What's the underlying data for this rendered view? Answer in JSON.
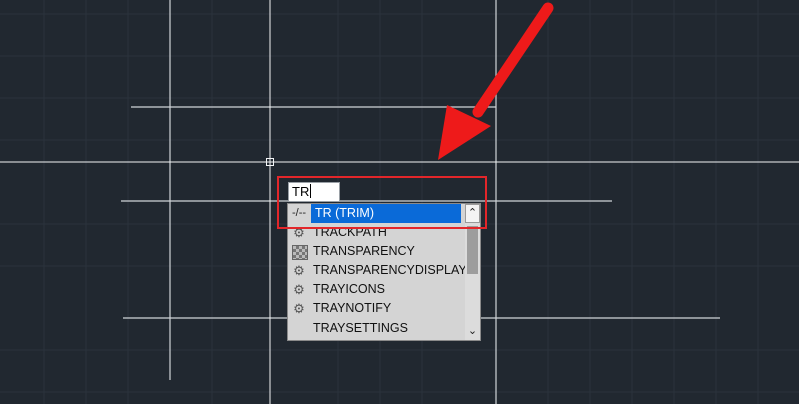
{
  "command_line": {
    "typed_text": "TR"
  },
  "autocomplete": {
    "items": [
      {
        "label": "TR (TRIM)",
        "icon": "trim-icon",
        "selected": true
      },
      {
        "label": "TRACKPATH",
        "icon": "gear-icon"
      },
      {
        "label": "TRANSPARENCY",
        "icon": "transparency-icon"
      },
      {
        "label": "TRANSPARENCYDISPLAY",
        "icon": "gear-icon"
      },
      {
        "label": "TRAYICONS",
        "icon": "gear-icon"
      },
      {
        "label": "TRAYNOTIFY",
        "icon": "gear-icon"
      },
      {
        "label": "TRAYSETTINGS",
        "icon": "none"
      }
    ],
    "scroll_up_glyph": "⌃",
    "scroll_down_glyph": "⌄"
  },
  "colors": {
    "background": "#212830",
    "selection": "#0a6ad8",
    "annotation": "#e3262a"
  }
}
